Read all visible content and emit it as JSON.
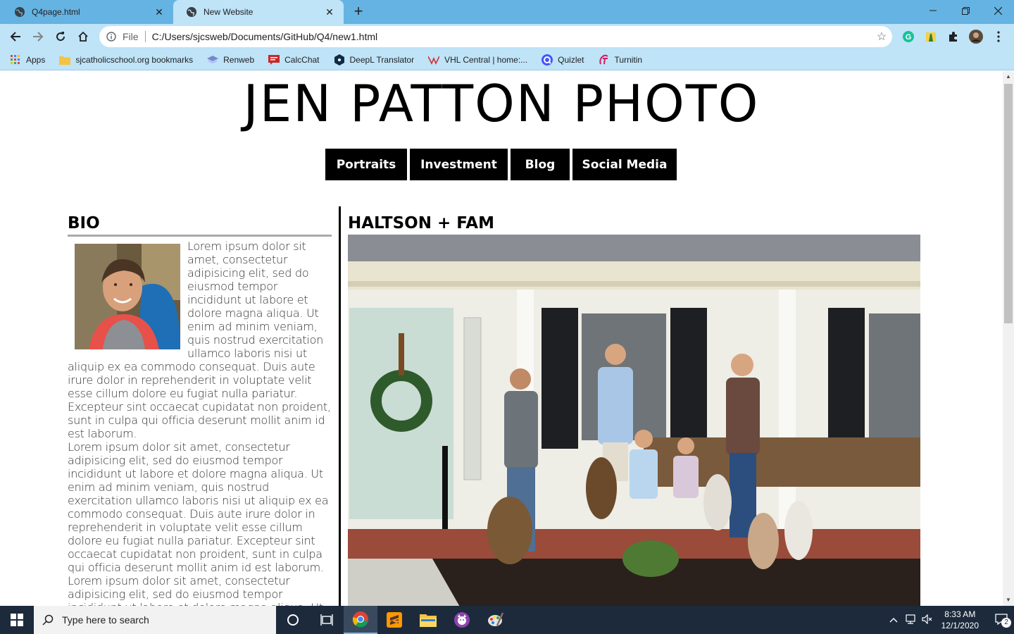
{
  "browser": {
    "tabs": [
      {
        "title": "Q4page.html",
        "active": false
      },
      {
        "title": "New Website",
        "active": true
      }
    ],
    "address": {
      "scheme": "File",
      "url": "C:/Users/sjcsweb/Documents/GitHub/Q4/new1.html"
    },
    "bookmarks": [
      {
        "label": "Apps",
        "icon": "apps-grid-icon"
      },
      {
        "label": "sjcatholicschool.org bookmarks",
        "icon": "folder-icon"
      },
      {
        "label": "Renweb",
        "icon": "renweb-icon"
      },
      {
        "label": "CalcChat",
        "icon": "calcchat-icon"
      },
      {
        "label": "DeepL Translator",
        "icon": "deepl-icon"
      },
      {
        "label": "VHL Central | home:...",
        "icon": "vhl-icon"
      },
      {
        "label": "Quizlet",
        "icon": "quizlet-icon"
      },
      {
        "label": "Turnitin",
        "icon": "turnitin-icon"
      }
    ],
    "colors": {
      "frame": "#65b3e2",
      "toolbar": "#bfe3f7"
    }
  },
  "page": {
    "title": "JEN PATTON PHOTO",
    "nav": [
      {
        "label": "Portraits"
      },
      {
        "label": "Investment"
      },
      {
        "label": "Blog"
      },
      {
        "label": "Social Media"
      }
    ],
    "bio": {
      "heading": "BIO",
      "paragraph1": "Lorem ipsum dolor sit amet, consectetur adipisicing elit, sed do eiusmod tempor incididunt ut labore et dolore magna aliqua. Ut enim ad minim veniam, quis nostrud exercitation ullamco laboris nisi ut aliquip ex ea commodo consequat. Duis aute irure dolor in reprehenderit in voluptate velit esse cillum dolore eu fugiat nulla pariatur. Excepteur sint occaecat cupidatat non proident, sunt in culpa qui officia deserunt mollit anim id est laborum.",
      "paragraph2": "Lorem ipsum dolor sit amet, consectetur adipisicing elit, sed do eiusmod tempor incididunt ut labore et dolore magna aliqua. Ut enim ad minim veniam, quis nostrud exercitation ullamco laboris nisi ut aliquip ex ea commodo consequat. Duis aute irure dolor in reprehenderit in voluptate velit esse cillum dolore eu fugiat nulla pariatur. Excepteur sint occaecat cupidatat non proident, sunt in culpa qui officia deserunt mollit anim id est laborum.",
      "paragraph3": "Lorem ipsum dolor sit amet, consectetur adipisicing elit, sed do eiusmod tempor incididunt ut labore et dolore magna aliqua. Ut"
    },
    "gallery": {
      "heading": "HALTSON + FAM"
    }
  },
  "taskbar": {
    "search_placeholder": "Type here to search",
    "time": "8:33 AM",
    "date": "12/1/2020",
    "notification_count": "2"
  }
}
